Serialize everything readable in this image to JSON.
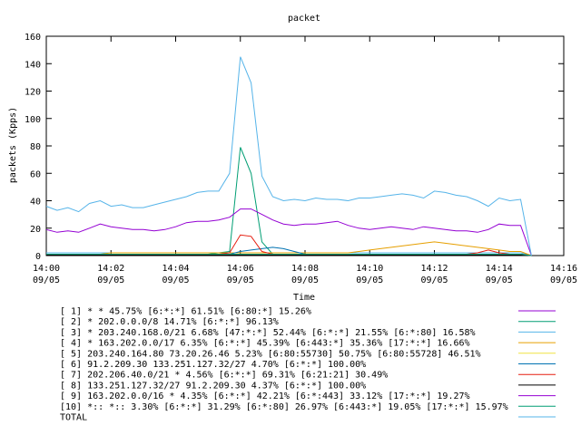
{
  "chart_data": {
    "type": "line",
    "title": "packet",
    "xlabel": "Time",
    "ylabel": "packets (Kpps)",
    "ylim": [
      0,
      160
    ],
    "xlim": [
      "14:00",
      "14:16"
    ],
    "y_ticks": [
      0,
      20,
      40,
      60,
      80,
      100,
      120,
      140,
      160
    ],
    "x_ticks": [
      {
        "time": "14:00",
        "date": "09/05"
      },
      {
        "time": "14:02",
        "date": "09/05"
      },
      {
        "time": "14:04",
        "date": "09/05"
      },
      {
        "time": "14:06",
        "date": "09/05"
      },
      {
        "time": "14:08",
        "date": "09/05"
      },
      {
        "time": "14:10",
        "date": "09/05"
      },
      {
        "time": "14:12",
        "date": "09/05"
      },
      {
        "time": "14:14",
        "date": "09/05"
      },
      {
        "time": "14:16",
        "date": "09/05"
      }
    ],
    "grid": false,
    "legend_position": "bottom",
    "x": [
      "14:00",
      "14:00:20",
      "14:00:40",
      "14:01",
      "14:01:20",
      "14:01:40",
      "14:02",
      "14:02:20",
      "14:02:40",
      "14:03",
      "14:03:20",
      "14:03:40",
      "14:04",
      "14:04:20",
      "14:04:40",
      "14:05",
      "14:05:20",
      "14:05:40",
      "14:06",
      "14:06:20",
      "14:06:40",
      "14:07",
      "14:07:20",
      "14:07:40",
      "14:08",
      "14:08:20",
      "14:08:40",
      "14:09",
      "14:09:20",
      "14:09:40",
      "14:10",
      "14:10:20",
      "14:10:40",
      "14:11",
      "14:11:20",
      "14:11:40",
      "14:12",
      "14:12:20",
      "14:12:40",
      "14:13",
      "14:13:20",
      "14:13:40",
      "14:14",
      "14:14:20",
      "14:14:40",
      "14:15"
    ],
    "series": [
      {
        "name": "[ 1] * * 45.75%  [6:*:*] 61.51% [6:80:*] 15.26%",
        "color": "#9400d3",
        "values": [
          1,
          1,
          1,
          1,
          1,
          1,
          1,
          1,
          1,
          1,
          1,
          1,
          1,
          1,
          1,
          1,
          1,
          1,
          1,
          1,
          1,
          1,
          1,
          1,
          1,
          1,
          1,
          1,
          1,
          1,
          1,
          1,
          1,
          1,
          1,
          1,
          1,
          1,
          1,
          1,
          1,
          1,
          1,
          1,
          1,
          0
        ]
      },
      {
        "name": "[ 2] * 202.0.0.0/8 14.71%  [6:*:*] 96.13%",
        "color": "#009e73",
        "values": [
          1,
          1,
          1,
          1,
          1,
          1,
          1,
          1,
          1,
          1,
          1,
          1,
          1,
          1,
          1,
          1,
          2,
          3,
          79,
          60,
          10,
          1,
          1,
          1,
          1,
          1,
          1,
          1,
          1,
          1,
          1,
          1,
          1,
          1,
          1,
          1,
          1,
          1,
          1,
          1,
          1,
          1,
          1,
          1,
          1,
          0
        ]
      },
      {
        "name": "[ 3] * 203.240.168.0/21 6.68%  [47:*:*] 52.44% [6:*:*] 21.55% [6:*:80] 16.58%",
        "color": "#56b4e9",
        "values": [
          2,
          2,
          2,
          2,
          2,
          2,
          2,
          2,
          2,
          2,
          2,
          2,
          2,
          2,
          2,
          2,
          2,
          2,
          2,
          2,
          2,
          2,
          2,
          2,
          2,
          2,
          2,
          2,
          2,
          2,
          2,
          2,
          2,
          2,
          2,
          2,
          2,
          2,
          2,
          2,
          2,
          2,
          2,
          2,
          2,
          0
        ]
      },
      {
        "name": "[ 4] * 163.202.0.0/17 6.35%  [6:*:*] 45.39% [6:443:*] 35.36% [17:*:*] 16.66%",
        "color": "#e69f00",
        "values": [
          1,
          1,
          1,
          1,
          1,
          1,
          2,
          2,
          2,
          2,
          2,
          2,
          2,
          2,
          2,
          2,
          2,
          2,
          2,
          2,
          2,
          2,
          2,
          2,
          2,
          2,
          2,
          2,
          2,
          3,
          4,
          5,
          6,
          7,
          8,
          9,
          10,
          9,
          8,
          7,
          6,
          5,
          4,
          3,
          3,
          0
        ]
      },
      {
        "name": "[ 5] 203.240.164.80 73.20.26.46 5.23%  [6:80:55730] 50.75% [6:80:55728] 46.51%",
        "color": "#f0e442",
        "values": [
          1,
          1,
          1,
          1,
          1,
          1,
          1,
          1,
          1,
          1,
          1,
          1,
          1,
          1,
          1,
          1,
          1,
          1,
          1,
          1,
          1,
          1,
          1,
          1,
          1,
          1,
          1,
          1,
          1,
          1,
          1,
          1,
          1,
          1,
          1,
          1,
          1,
          1,
          1,
          1,
          1,
          1,
          1,
          1,
          1,
          0
        ]
      },
      {
        "name": "[ 6] 91.2.209.30 133.251.127.32/27 4.70%  [6:*:*] 100.00%",
        "color": "#0072b2",
        "values": [
          1,
          1,
          1,
          1,
          1,
          1,
          1,
          1,
          1,
          1,
          1,
          1,
          1,
          1,
          1,
          1,
          1,
          1,
          3,
          4,
          5,
          6,
          5,
          3,
          1,
          1,
          1,
          1,
          1,
          1,
          1,
          1,
          1,
          1,
          1,
          1,
          1,
          1,
          1,
          1,
          1,
          1,
          1,
          1,
          1,
          0
        ]
      },
      {
        "name": "[ 7] 202.206.40.0/21 * 4.56%  [6:*:*] 69.31% [6:21:21] 30.49%",
        "color": "#e51e10",
        "values": [
          1,
          1,
          1,
          1,
          1,
          1,
          1,
          1,
          1,
          1,
          1,
          1,
          1,
          1,
          1,
          1,
          1,
          2,
          15,
          14,
          3,
          1,
          1,
          1,
          1,
          1,
          1,
          1,
          1,
          1,
          1,
          1,
          1,
          1,
          1,
          1,
          1,
          1,
          1,
          1,
          2,
          4,
          2,
          1,
          1,
          0
        ]
      },
      {
        "name": "[ 8] 133.251.127.32/27 91.2.209.30 4.37%  [6:*:*] 100.00%",
        "color": "#000000",
        "values": [
          0.5,
          0.5,
          0.5,
          0.5,
          0.5,
          0.5,
          0.5,
          0.5,
          0.5,
          0.5,
          0.5,
          0.5,
          0.5,
          0.5,
          0.5,
          0.5,
          0.5,
          0.5,
          0.5,
          0.5,
          0.5,
          0.5,
          0.5,
          0.5,
          0.5,
          0.5,
          0.5,
          0.5,
          0.5,
          0.5,
          0.5,
          0.5,
          0.5,
          0.5,
          0.5,
          0.5,
          0.5,
          0.5,
          0.5,
          0.5,
          0.5,
          0.5,
          0.5,
          0.5,
          0.5,
          0
        ]
      },
      {
        "name": "[ 9] 163.202.0.0/16 * 4.35%  [6:*:*] 42.21% [6:*:443] 33.12% [17:*:*] 19.27%",
        "color": "#9400d3",
        "values": [
          19,
          17,
          18,
          17,
          20,
          23,
          21,
          20,
          19,
          19,
          18,
          19,
          21,
          24,
          25,
          25,
          26,
          28,
          34,
          34,
          30,
          26,
          23,
          22,
          23,
          23,
          24,
          25,
          22,
          20,
          19,
          20,
          21,
          20,
          19,
          21,
          20,
          19,
          18,
          18,
          17,
          19,
          23,
          22,
          22,
          0
        ]
      },
      {
        "name": "[10] *:: *:: 3.30%  [6:*:*] 31.29% [6:*:80] 26.97% [6:443:*] 19.05% [17:*:*] 15.97%",
        "color": "#009e73",
        "values": [
          1,
          1,
          1,
          1,
          1,
          1,
          1,
          1,
          1,
          1,
          1,
          1,
          1,
          1,
          1,
          1,
          1,
          1,
          1,
          1,
          1,
          1,
          1,
          1,
          1,
          1,
          1,
          1,
          1,
          1,
          1,
          1,
          1,
          1,
          1,
          1,
          1,
          1,
          1,
          1,
          1,
          1,
          1,
          1,
          1,
          0
        ]
      },
      {
        "name": "TOTAL",
        "color": "#56b4e9",
        "values": [
          36,
          33,
          35,
          32,
          38,
          40,
          36,
          37,
          35,
          35,
          37,
          39,
          41,
          43,
          46,
          47,
          47,
          60,
          145,
          126,
          58,
          43,
          40,
          41,
          40,
          42,
          41,
          41,
          40,
          42,
          42,
          43,
          44,
          45,
          44,
          42,
          47,
          46,
          44,
          43,
          40,
          36,
          42,
          40,
          41,
          0
        ]
      }
    ]
  }
}
